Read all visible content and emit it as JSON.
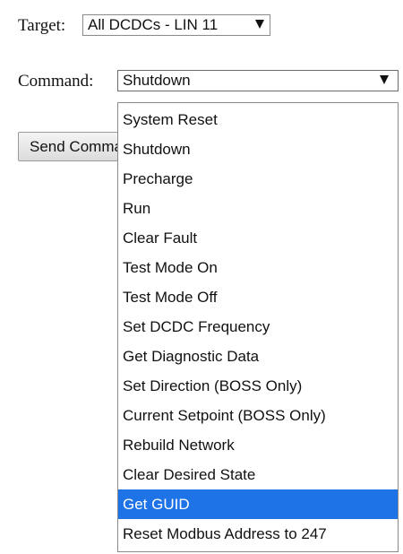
{
  "target": {
    "label": "Target:",
    "selected": "All DCDCs - LIN 11"
  },
  "command": {
    "label": "Command:",
    "selected": "Shutdown",
    "highlighted_index": 14,
    "options": [
      "System Reset",
      "Shutdown",
      "Precharge",
      "Run",
      "Clear Fault",
      "Test Mode On",
      "Test Mode Off",
      "Set DCDC Frequency",
      "Get Diagnostic Data",
      "Set Direction (BOSS Only)",
      "Current Setpoint (BOSS Only)",
      "Rebuild Network",
      "Clear Desired State",
      "Get GUID",
      "Reset Modbus Address to 247"
    ]
  },
  "send_button": {
    "label": "Send Command"
  },
  "colors": {
    "highlight": "#1e73e6",
    "highlight_text": "#ffffff"
  },
  "icons": {
    "dropdown_arrow": "chevron-down-icon"
  }
}
